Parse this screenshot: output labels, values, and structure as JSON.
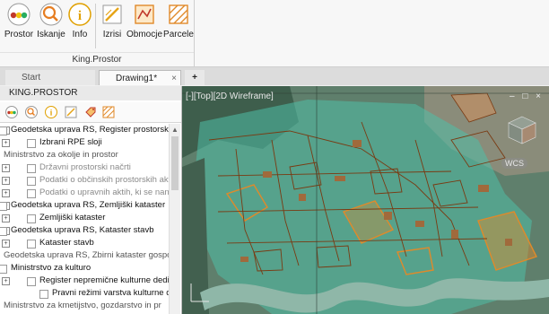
{
  "ribbon": {
    "buttons": [
      {
        "label": "Prostor",
        "icon": "prostor-icon"
      },
      {
        "label": "Iskanje",
        "icon": "search-icon"
      },
      {
        "label": "Info",
        "icon": "info-icon"
      },
      {
        "label": "Izrisi",
        "icon": "izrisi-icon"
      },
      {
        "label": "Obmocje",
        "icon": "obmocje-icon"
      },
      {
        "label": "Parcele",
        "icon": "parcele-icon"
      }
    ],
    "group_label": "King.Prostor"
  },
  "tabs": {
    "start": "Start",
    "drawing": "Drawing1*",
    "close": "×",
    "add": "+"
  },
  "panel": {
    "title": "KING.PROSTOR",
    "rows": [
      {
        "text": "Geodetska uprava RS, Register prostorsk",
        "style": "dark",
        "indent": 12,
        "cb": true,
        "exp": true
      },
      {
        "text": "Izbrani RPE sloji",
        "style": "dark",
        "indent": 44,
        "cb": true,
        "exp": true
      },
      {
        "text": "Ministrstvo za okolje in prostor",
        "style": "header",
        "indent": 4,
        "cb": false,
        "exp": false
      },
      {
        "text": "Državni prostorski načrti",
        "style": "gray",
        "indent": 44,
        "cb": true,
        "exp": true
      },
      {
        "text": "Podatki o občinskih prostorskih akti",
        "style": "gray",
        "indent": 44,
        "cb": true,
        "exp": true
      },
      {
        "text": "Podatki o upravnih aktih, ki se nana",
        "style": "gray",
        "indent": 44,
        "cb": true,
        "exp": true
      },
      {
        "text": "Geodetska uprava RS, Zemljiški kataster",
        "style": "dark",
        "indent": 12,
        "cb": true,
        "exp": true
      },
      {
        "text": "Zemljiški kataster",
        "style": "dark",
        "indent": 44,
        "cb": true,
        "exp": true
      },
      {
        "text": "Geodetska uprava RS, Kataster stavb",
        "style": "dark",
        "indent": 12,
        "cb": true,
        "exp": true
      },
      {
        "text": "Kataster stavb",
        "style": "dark",
        "indent": 44,
        "cb": true,
        "exp": true
      },
      {
        "text": "Geodetska uprava RS, Zbirni kataster gospo",
        "style": "header",
        "indent": 4,
        "cb": false,
        "exp": false
      },
      {
        "text": "Ministrstvo za kulturo",
        "style": "dark",
        "indent": 12,
        "cb": true,
        "exp": false
      },
      {
        "text": "Register nepremične kulturne dediš",
        "style": "dark",
        "indent": 44,
        "cb": true,
        "exp": true
      },
      {
        "text": "Pravni režimi varstva kulturne de",
        "style": "dark",
        "indent": 58,
        "cb": true,
        "exp": false
      },
      {
        "text": "Ministrstvo za kmetijstvo, gozdarstvo in pr",
        "style": "header",
        "indent": 4,
        "cb": false,
        "exp": false
      }
    ]
  },
  "map": {
    "view_label": "[-][Top][2D Wireframe]",
    "window_controls": "– □ ×",
    "wcs": "WCS"
  },
  "colors": {
    "map_base": "#6d8f7a",
    "protected_zone": "#4fc0a8",
    "parcel_outline": "#7a3a12",
    "heritage_orange": "#e08a2a"
  }
}
